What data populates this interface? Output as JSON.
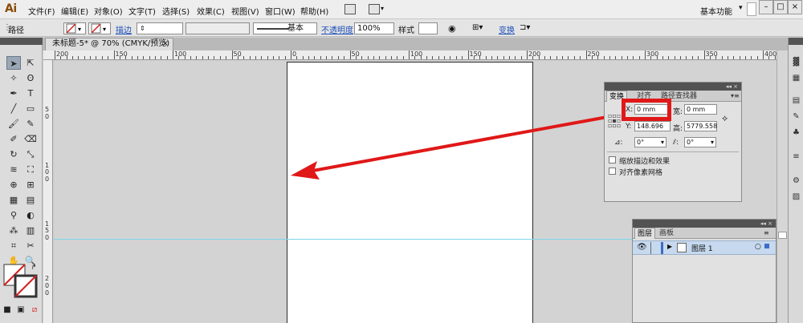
{
  "app": {
    "logo": "Ai",
    "menu": [
      "文件(F)",
      "编辑(E)",
      "对象(O)",
      "文字(T)",
      "选择(S)",
      "效果(C)",
      "视图(V)",
      "窗口(W)",
      "帮助(H)"
    ],
    "workspace": "基本功能"
  },
  "control_bar": {
    "object_type": "路径",
    "stroke_label": "描边",
    "stroke_style": "基本",
    "opacity_label": "不透明度",
    "opacity_value": "100%",
    "style_label": "样式",
    "transform_label": "变换"
  },
  "document_tab": {
    "title": "未标题-5* @ 70% (CMYK/预览)",
    "close": "×"
  },
  "ruler": {
    "h_labels": [
      "200",
      "150",
      "100",
      "50",
      "0",
      "50",
      "100",
      "150",
      "200",
      "250",
      "300",
      "350",
      "400"
    ],
    "v_labels": [
      "5",
      "0",
      "1",
      "0",
      "0",
      "1",
      "5",
      "0",
      "2",
      "0",
      "0"
    ]
  },
  "transform_panel": {
    "tabs": [
      "变换",
      "对齐",
      "路径查找器"
    ],
    "x_label": "X:",
    "x_value": "0 mm",
    "w_label": "宽:",
    "w_value": "0 mm",
    "y_label": "Y:",
    "y_value": "148.696",
    "h_label": "高:",
    "h_value": "5779.558",
    "rotate_value": "0°",
    "shear_value": "0°",
    "scale_strokes": "缩放描边和效果",
    "align_pixel": "对齐像素网格"
  },
  "layers_panel": {
    "tabs": [
      "图层",
      "画板"
    ],
    "layer_name": "图层 1"
  },
  "colors": {
    "annotation_red": "#e01818",
    "guide_cyan": "#7ad8e8",
    "layer_highlight": "#c6d9ee",
    "panel_header": "#525252"
  }
}
